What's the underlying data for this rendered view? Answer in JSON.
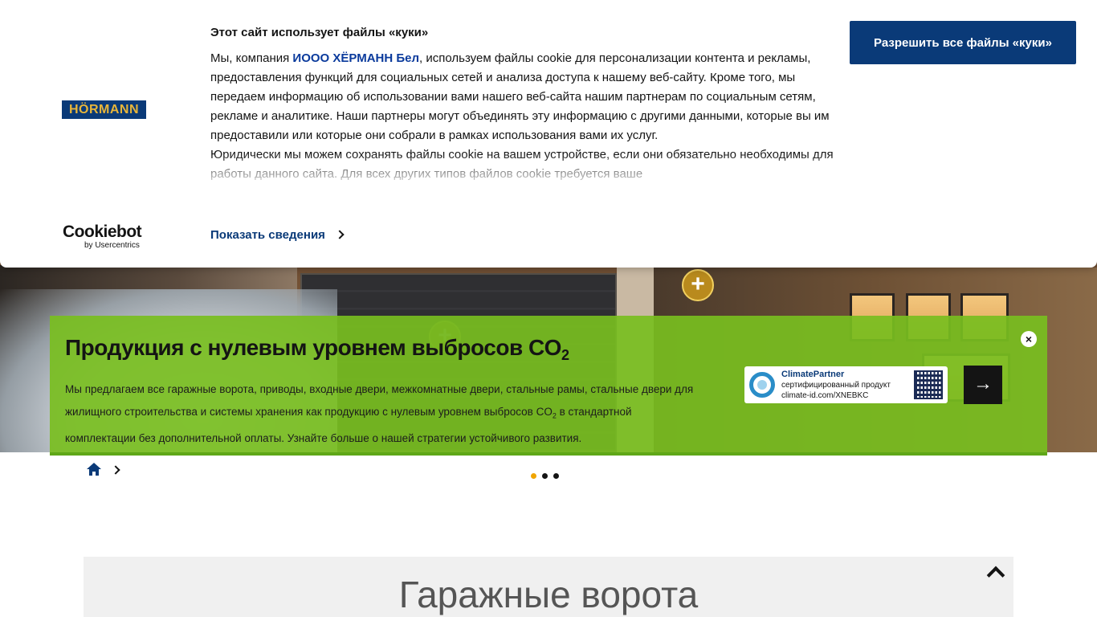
{
  "cookie_banner": {
    "brand_logo_text": "HÖRMANN",
    "title": "Этот сайт использует файлы «куки»",
    "body_prefix": "Мы, компания ",
    "company_name": "ИООО ХЁРМАНН Бел",
    "body_p1_rest": ",  используем файлы cookie для персонализации контента и рекламы, предоставления функций для социальных сетей и анализа доступа к нашему веб-сайту. Кроме того, мы передаем информацию об использовании вами нашего веб-сайта нашим партнерам по социальным сетям, рекламе и аналитике. Наши партнеры могут объединять эту информацию с другими данными, которые вы им предоставили или которые они собрали в рамках использования вами их услуг.",
    "body_p2": "Юридически мы можем сохранять файлы cookie на вашем устройстве, если они обязательно необходимы для работы данного сайта. Для всех других типов файлов cookie требуется ваше",
    "show_details_label": "Показать сведения",
    "allow_all_label": "Разрешить все файлы «куки»",
    "cookiebot_name": "Cookiebot",
    "cookiebot_sub": "by Usercentrics"
  },
  "hero": {
    "hotspots": [
      "+",
      "+"
    ]
  },
  "promo": {
    "title_main": "Продукция с нулевым уровнем выбросов CO",
    "title_sub": "2",
    "text_part1": "Мы предлагаем все гаражные ворота, приводы, входные двери, межкомнатные двери, стальные рамы, стальные двери для жилищного строительства и системы хранения как продукцию с нулевым уровнем выбросов CO",
    "text_sub": "2",
    "text_part2": " в стандартной комплектации без дополнительной оплаты. Узнайте больше о нашей стратегии устойчивого развития.",
    "close_symbol": "×",
    "next_symbol": "→",
    "badge": {
      "line1": "ClimatePartner",
      "line2": "сертифицированный продукт",
      "line3": "climate-id.com/XNEBKC"
    }
  },
  "carousel": {
    "active_index": 0,
    "count": 3
  },
  "section": {
    "title": "Гаражные ворота"
  },
  "colors": {
    "brand_blue": "#0a3a78",
    "promo_green": "#78be20",
    "active_dot": "#f0a500"
  },
  "icons": {
    "home": "home-icon",
    "chevron": "chevron-right-icon",
    "scroll_top": "chevron-up-icon",
    "close": "close-icon",
    "next": "arrow-right-icon"
  }
}
